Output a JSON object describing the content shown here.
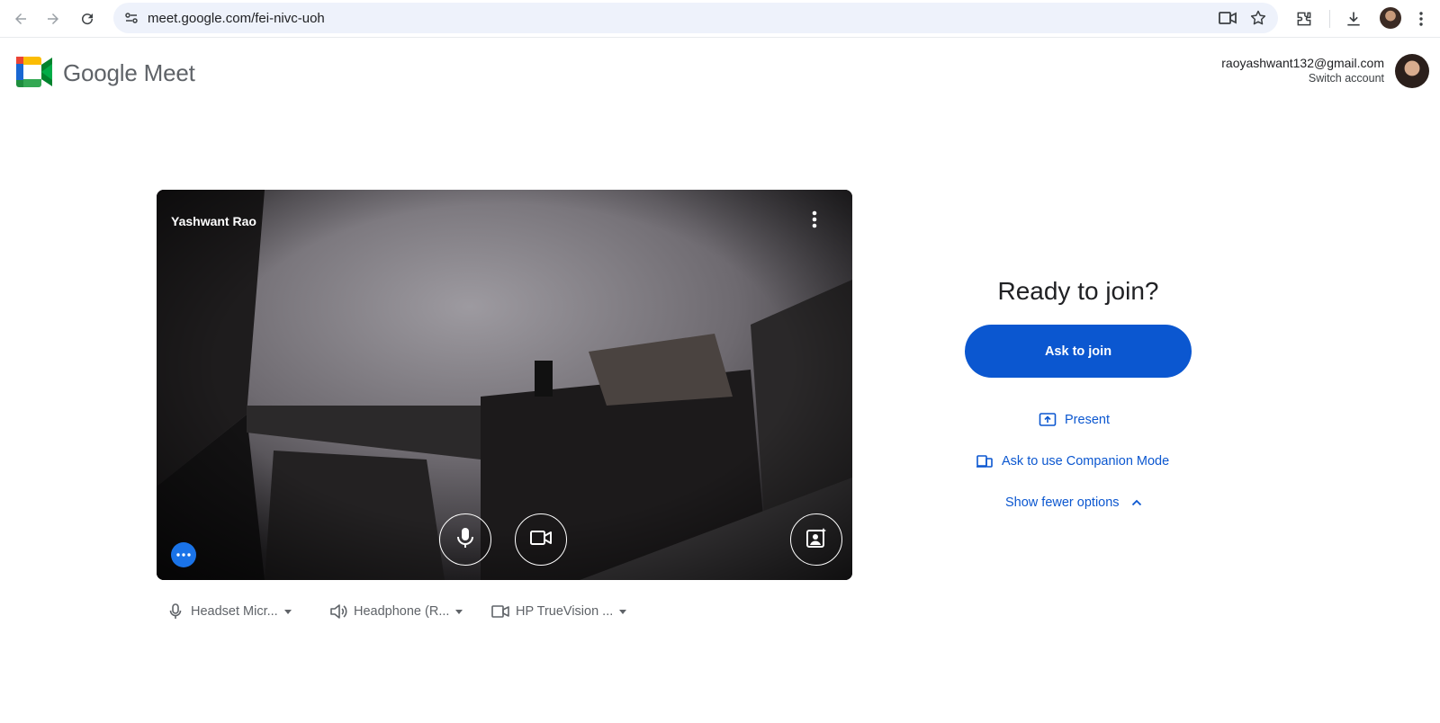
{
  "browser": {
    "url": "meet.google.com/fei-nivc-uoh",
    "icons": [
      "back-icon",
      "forward-icon",
      "reload-icon",
      "site-settings-icon",
      "camera-in-use-icon",
      "bookmark-star-icon",
      "extensions-icon",
      "download-icon",
      "profile-avatar",
      "menu-icon"
    ]
  },
  "header": {
    "app_name": "Google Meet",
    "account_email": "raoyashwant132@gmail.com",
    "switch_account": "Switch account"
  },
  "preview": {
    "participant_name": "Yashwant Rao",
    "controls": [
      "mic-icon",
      "camera-icon",
      "visual-effects-icon",
      "more-options-icon"
    ]
  },
  "devices": {
    "microphone": "Headset Micr...",
    "speaker": "Headphone (R...",
    "camera": "HP TrueVision ..."
  },
  "join": {
    "title": "Ready to join?",
    "ask_to_join": "Ask to join",
    "present": "Present",
    "companion_mode": "Ask to use Companion Mode",
    "show_fewer": "Show fewer options"
  },
  "colors": {
    "primary_blue": "#0b57d0",
    "link_blue": "#0b57d0",
    "dots_blue": "#1a73e8"
  }
}
